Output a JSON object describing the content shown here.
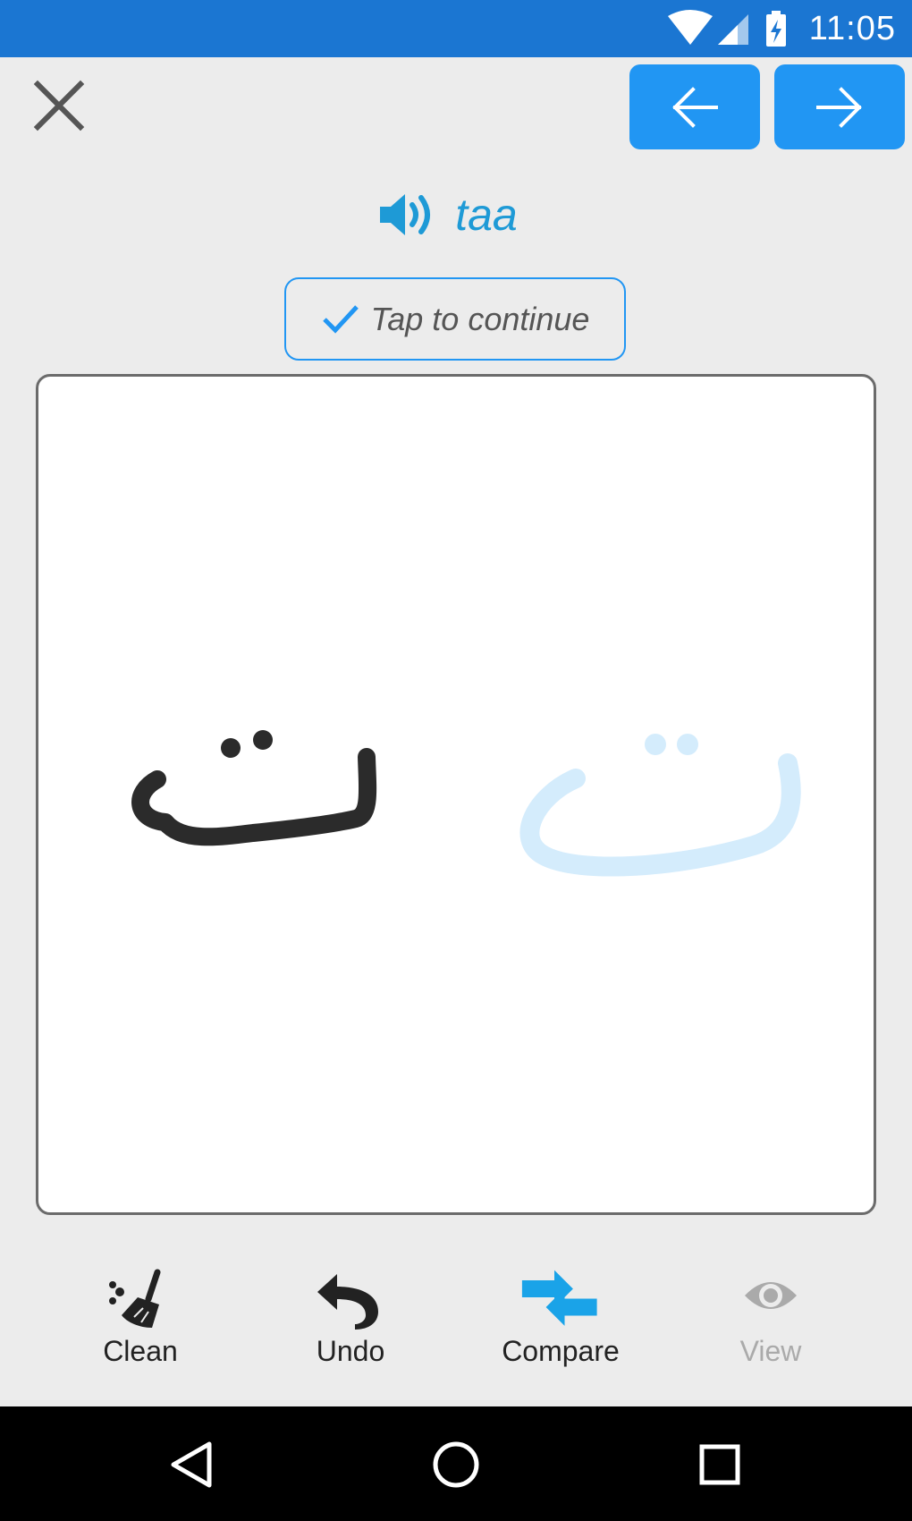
{
  "status_bar": {
    "time": "11:05",
    "icons": [
      "wifi-icon",
      "cell-signal-icon",
      "battery-charging-icon"
    ],
    "color": "#1b76d2"
  },
  "header": {
    "close_icon": "close-icon",
    "prev_icon": "arrow-left-icon",
    "next_icon": "arrow-right-icon",
    "accent": "#2196f3"
  },
  "word": {
    "icon": "speaker-icon",
    "text": "taa",
    "color": "#1e9ad6"
  },
  "continue_button": {
    "icon": "check-icon",
    "label": "Tap to continue"
  },
  "canvas": {
    "user_stroke_color": "#2b2b2b",
    "guide_stroke_color": "#d4ecfc"
  },
  "toolbar": {
    "items": [
      {
        "label": "Clean",
        "icon": "broom-icon",
        "enabled": true
      },
      {
        "label": "Undo",
        "icon": "undo-icon",
        "enabled": true
      },
      {
        "label": "Compare",
        "icon": "compare-arrows-icon",
        "enabled": true,
        "active": true
      },
      {
        "label": "View",
        "icon": "eye-icon",
        "enabled": false
      }
    ]
  },
  "nav_bar": {
    "icons": [
      "back-icon",
      "home-icon",
      "recents-icon"
    ]
  }
}
